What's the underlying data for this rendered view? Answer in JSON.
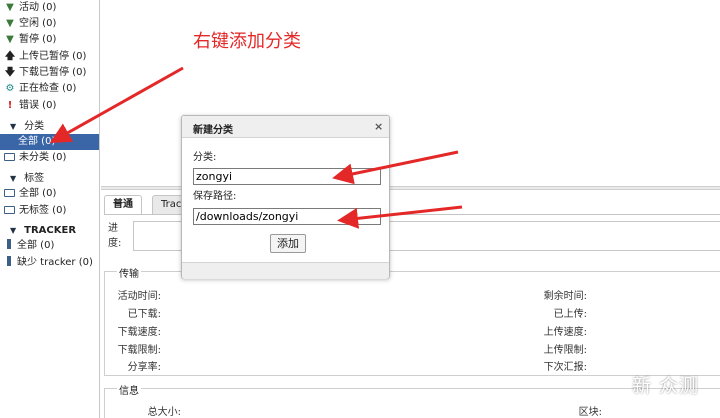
{
  "sidebar": {
    "status_items": [
      {
        "label": "活动 (0)",
        "icon": "filter-icon"
      },
      {
        "label": "空闲 (0)",
        "icon": "filter-icon"
      },
      {
        "label": "暂停 (0)",
        "icon": "filter-icon"
      },
      {
        "label": "上传已暂停 (0)",
        "icon": "up-arrow-icon"
      },
      {
        "label": "下载已暂停 (0)",
        "icon": "down-arrow-icon"
      },
      {
        "label": "正在检查 (0)",
        "icon": "gear-icon"
      },
      {
        "label": "错误 (0)",
        "icon": "exclamation-icon"
      }
    ],
    "categories_header": "分类",
    "categories": [
      {
        "label": "全部 (0)",
        "selected": true
      },
      {
        "label": "未分类 (0)"
      }
    ],
    "tags_header": "标签",
    "tags": [
      {
        "label": "全部 (0)"
      },
      {
        "label": "无标签 (0)"
      }
    ],
    "trackers_header": "TRACKER",
    "trackers": [
      {
        "label": "全部 (0)"
      },
      {
        "label": "缺少 tracker (0)"
      }
    ]
  },
  "tabs": [
    {
      "label": "普通",
      "active": true
    },
    {
      "label": "Track"
    }
  ],
  "progress_label": "进度:",
  "transfer": {
    "legend": "传输",
    "left_fields": [
      "活动时间:",
      "已下载:",
      "下载速度:",
      "下载限制:",
      "分享率:"
    ],
    "right_fields": [
      "剩余时间:",
      "已上传:",
      "上传速度:",
      "上传限制:",
      "下次汇报:"
    ]
  },
  "info": {
    "legend": "信息",
    "left_fields": [
      "总大小:"
    ],
    "right_fields": [
      "区块:"
    ]
  },
  "dialog": {
    "title": "新建分类",
    "category_label": "分类:",
    "category_value": "zongyi",
    "save_path_label": "保存路径:",
    "save_path_value": "/downloads/zongyi",
    "add_button": "添加",
    "close": "×"
  },
  "annotation": "右键添加分类",
  "watermark": "新 众测",
  "colors": {
    "selected_bg": "#3a66a7",
    "annotation_red": "#e42828"
  }
}
